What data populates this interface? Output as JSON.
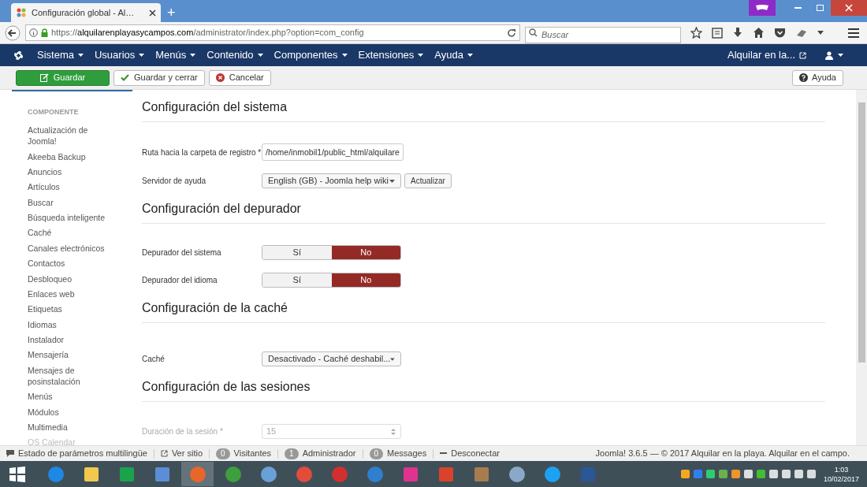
{
  "browser": {
    "tab_title": "Configuración global - Al…",
    "new_tab": "+",
    "url": {
      "host": "alquilarenplayasycampos.com",
      "path": "/administrator/index.php?option=com_config",
      "scheme": "https://"
    },
    "search_placeholder": "Buscar"
  },
  "nav": {
    "menus": [
      "Sistema",
      "Usuarios",
      "Menús",
      "Contenido",
      "Componentes",
      "Extensiones",
      "Ayuda"
    ],
    "site_link": "Alquilar en la..."
  },
  "toolbar": {
    "buttons": [
      {
        "label": "Guardar",
        "kind": "primary"
      },
      {
        "label": "Guardar y cerrar",
        "kind": "check"
      },
      {
        "label": "Cancelar",
        "kind": "cancel"
      }
    ],
    "help": "Ayuda"
  },
  "sidebar": {
    "heading": "COMPONENTE",
    "items": [
      "Actualización de Joomla!",
      "Akeeba Backup",
      "Anuncios",
      "Artículos",
      "Buscar",
      "Búsqueda inteligente",
      "Caché",
      "Canales electrónicos",
      "Contactos",
      "Desbloqueo",
      "Enlaces web",
      "Etiquetas",
      "Idiomas",
      "Instalador",
      "Mensajería",
      "Mensajes de posinstalación",
      "Menús",
      "Módulos",
      "Multimedia",
      "OS Calendar"
    ]
  },
  "sections": [
    {
      "title": "Configuración del sistema",
      "fields": [
        {
          "kind": "text",
          "label": "Ruta hacia la carpeta de registro *",
          "value": "/home/inmobil1/public_html/alquilare"
        },
        {
          "kind": "select",
          "label": "Servidor de ayuda",
          "value": "English (GB) - Joomla help wiki",
          "button": "Actualizar"
        }
      ]
    },
    {
      "title": "Configuración del depurador",
      "fields": [
        {
          "kind": "toggle",
          "label": "Depurador del sistema",
          "options": [
            {
              "label": "Sí",
              "selected": false
            },
            {
              "label": "No",
              "selected": true
            }
          ]
        },
        {
          "kind": "toggle",
          "label": "Depurador del idioma",
          "options": [
            {
              "label": "Sí",
              "selected": false
            },
            {
              "label": "No",
              "selected": true
            }
          ]
        }
      ]
    },
    {
      "title": "Configuración de la caché",
      "fields": [
        {
          "kind": "select",
          "label": "Caché",
          "value": "Desactivado - Caché deshabil..."
        }
      ]
    },
    {
      "title": "Configuración de las sesiones",
      "fields": [
        {
          "kind": "number",
          "label": "Duración de la sesión *",
          "value": "15"
        }
      ]
    }
  ],
  "status_bar": {
    "items": [
      {
        "kind": "comment",
        "label": "Estado de parámetros multilingüe"
      },
      {
        "kind": "link",
        "label": "Ver sitio"
      },
      {
        "kind": "count",
        "count": "0",
        "label": "Visitantes"
      },
      {
        "kind": "count",
        "count": "1",
        "label": "Administrador"
      },
      {
        "kind": "count",
        "count": "0",
        "label": "Messages"
      },
      {
        "kind": "logout",
        "label": "Desconectar"
      }
    ],
    "footer": "Joomla! 3.6.5 — © 2017 Alquilar en la playa. Alquilar en el campo."
  },
  "taskbar": {
    "time": "1:03",
    "date": "10/02/2017"
  }
}
